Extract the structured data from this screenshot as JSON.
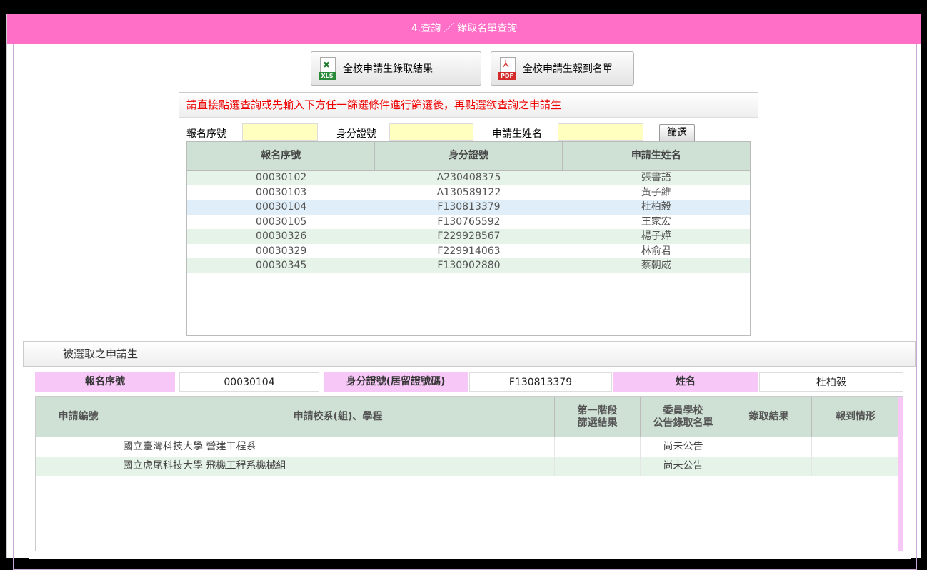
{
  "title": "4.查詢 ／ 錄取名單查詢",
  "export_buttons": {
    "xls": {
      "icon": "xls-file-icon",
      "tag": "XLS",
      "label": "全校申請生錄取結果"
    },
    "pdf": {
      "icon": "pdf-file-icon",
      "tag": "PDF",
      "label": "全校申請生報到名單"
    }
  },
  "search": {
    "instruction": "請直接點選查詢或先輸入下方任一篩選條件進行篩選後，再點選欲查詢之申請生",
    "filters": {
      "reg_no_label": "報名序號",
      "reg_no_value": "",
      "id_label": "身分證號",
      "id_value": "",
      "name_label": "申請生姓名",
      "name_value": "",
      "button": "篩選"
    },
    "columns": [
      "報名序號",
      "身分證號",
      "申請生姓名"
    ],
    "rows": [
      [
        "00030102",
        "A230408375",
        "張書語"
      ],
      [
        "00030103",
        "A130589122",
        "黃子維"
      ],
      [
        "00030104",
        "F130813379",
        "杜柏毅"
      ],
      [
        "00030105",
        "F130765592",
        "王家宏"
      ],
      [
        "00030326",
        "F229928567",
        "楊子嬅"
      ],
      [
        "00030329",
        "F229914063",
        "林俞君"
      ],
      [
        "00030345",
        "F130902880",
        "蔡朝威"
      ]
    ],
    "selected_index": 2
  },
  "selected": {
    "section_title": "被選取之申請生",
    "reg_label": "報名序號",
    "reg_value": "00030104",
    "id_label": "身分證號(居留證號碼)",
    "id_value": "F130813379",
    "name_label": "姓名",
    "name_value": "杜柏毅"
  },
  "applications": {
    "columns": [
      "申請編號",
      "申請校系(組)、學程",
      "第一階段\n篩選結果",
      "委員學校\n公告錄取名單",
      "錄取結果",
      "報到情形"
    ],
    "rows": [
      [
        "",
        "國立臺灣科技大學 營建工程系",
        "",
        "尚未公告",
        "",
        ""
      ],
      [
        "",
        "國立虎尾科技大學 飛機工程系機械組",
        "",
        "尚未公告",
        "",
        ""
      ]
    ]
  }
}
